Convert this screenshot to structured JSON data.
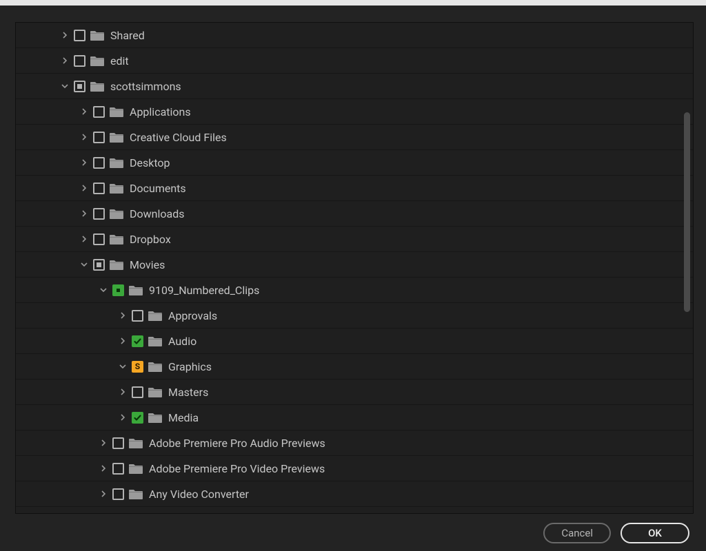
{
  "buttons": {
    "cancel": "Cancel",
    "ok": "OK"
  },
  "tree": [
    {
      "indent": 0,
      "expanded": false,
      "check": "empty",
      "label": "Shared"
    },
    {
      "indent": 0,
      "expanded": false,
      "check": "empty",
      "label": "edit"
    },
    {
      "indent": 0,
      "expanded": true,
      "check": "dot",
      "label": "scottsimmons"
    },
    {
      "indent": 1,
      "expanded": false,
      "check": "empty",
      "label": "Applications"
    },
    {
      "indent": 1,
      "expanded": false,
      "check": "empty",
      "label": "Creative Cloud Files"
    },
    {
      "indent": 1,
      "expanded": false,
      "check": "empty",
      "label": "Desktop"
    },
    {
      "indent": 1,
      "expanded": false,
      "check": "empty",
      "label": "Documents"
    },
    {
      "indent": 1,
      "expanded": false,
      "check": "empty",
      "label": "Downloads"
    },
    {
      "indent": 1,
      "expanded": false,
      "check": "empty",
      "label": "Dropbox"
    },
    {
      "indent": 1,
      "expanded": true,
      "check": "dot",
      "label": "Movies"
    },
    {
      "indent": 2,
      "expanded": true,
      "check": "greendot",
      "label": "9109_Numbered_Clips"
    },
    {
      "indent": 3,
      "expanded": false,
      "check": "empty",
      "label": "Approvals"
    },
    {
      "indent": 3,
      "expanded": false,
      "check": "greencheck",
      "label": "Audio"
    },
    {
      "indent": 3,
      "expanded": true,
      "check": "orange",
      "label": "Graphics"
    },
    {
      "indent": 3,
      "expanded": false,
      "check": "empty",
      "label": "Masters"
    },
    {
      "indent": 3,
      "expanded": false,
      "check": "greencheck",
      "label": "Media"
    },
    {
      "indent": 2,
      "expanded": false,
      "check": "empty",
      "label": "Adobe Premiere Pro Audio Previews"
    },
    {
      "indent": 2,
      "expanded": false,
      "check": "empty",
      "label": "Adobe Premiere Pro Video Previews"
    },
    {
      "indent": 2,
      "expanded": false,
      "check": "empty",
      "label": "Any Video Converter"
    }
  ]
}
